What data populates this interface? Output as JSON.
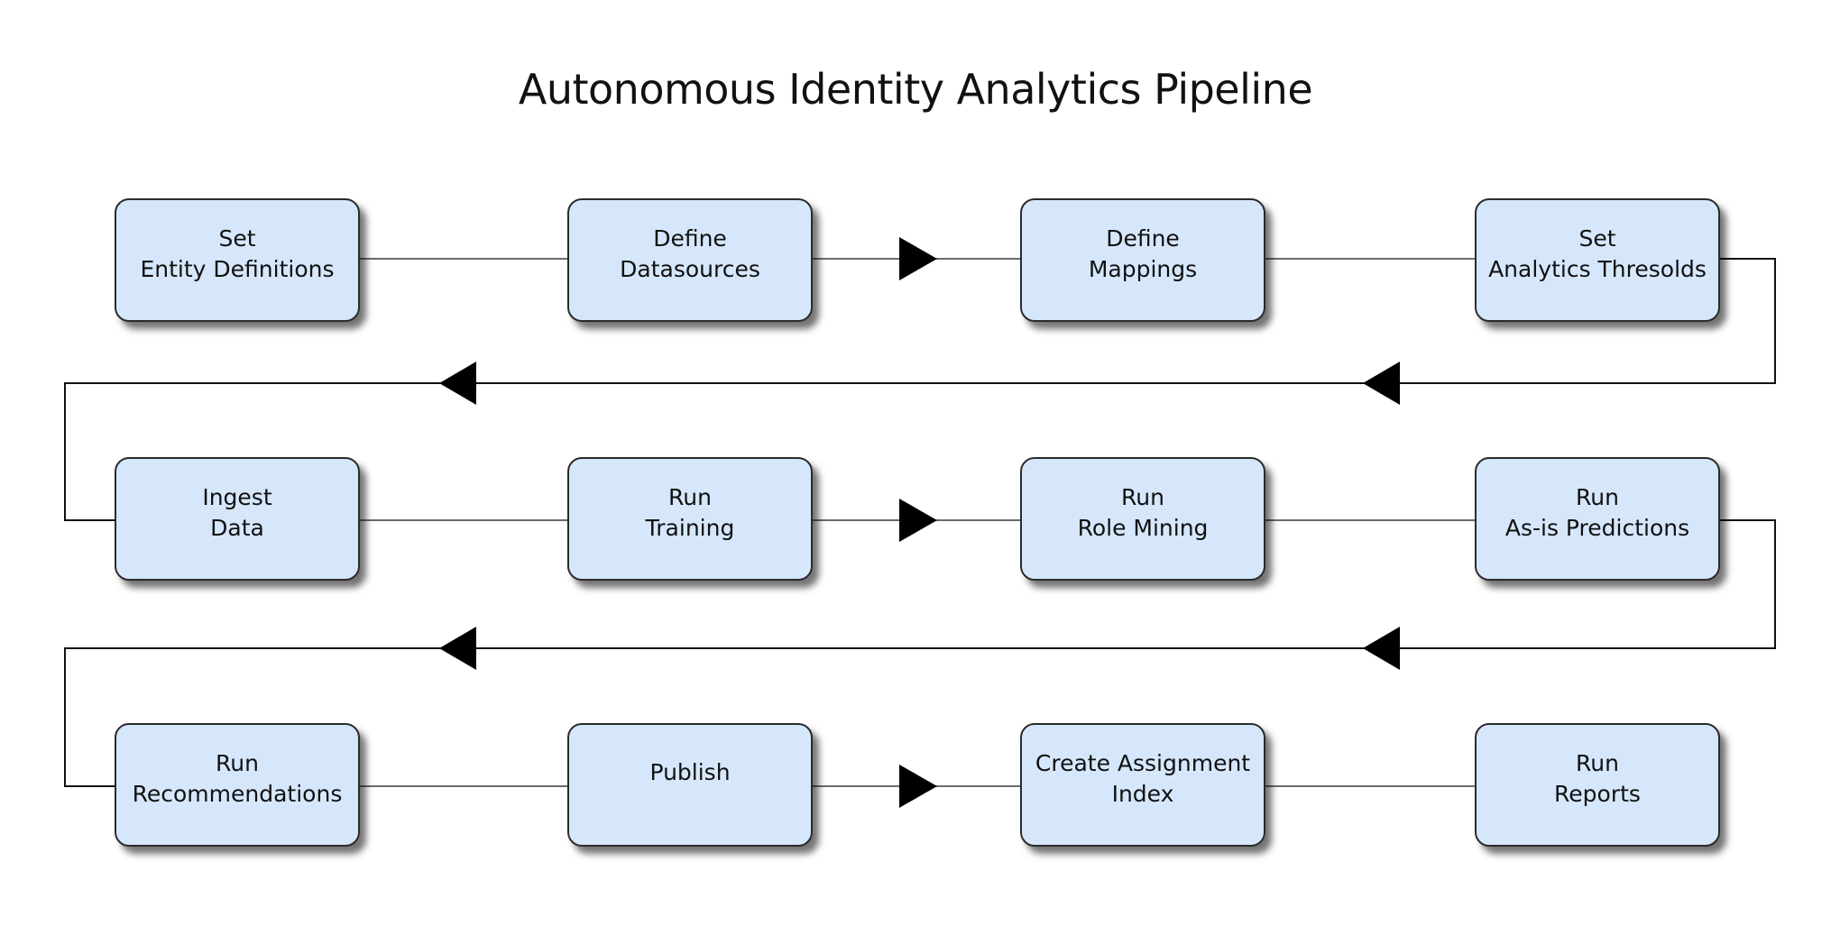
{
  "title": "Autonomous Identity Analytics Pipeline",
  "colors": {
    "node_fill": "#d6e7fb",
    "node_border": "#2b2b2b",
    "connector": "#6b6b6b",
    "return_line": "#111111",
    "arrow": "#000000"
  },
  "rows": [
    {
      "direction": "left-to-right",
      "steps": [
        {
          "lines": [
            "Set",
            "Entity Definitions"
          ]
        },
        {
          "lines": [
            "Define",
            "Datasources"
          ]
        },
        {
          "lines": [
            "Define",
            "Mappings"
          ]
        },
        {
          "lines": [
            "Set",
            "Analytics Thresolds"
          ]
        }
      ]
    },
    {
      "direction": "left-to-right",
      "steps": [
        {
          "lines": [
            "Ingest",
            "Data"
          ]
        },
        {
          "lines": [
            "Run",
            "Training"
          ]
        },
        {
          "lines": [
            "Run",
            "Role Mining"
          ]
        },
        {
          "lines": [
            "Run",
            "As-is Predictions"
          ]
        }
      ]
    },
    {
      "direction": "left-to-right",
      "steps": [
        {
          "lines": [
            "Run",
            "Recommendations"
          ]
        },
        {
          "lines": [
            "Publish"
          ]
        },
        {
          "lines": [
            "Create Assignment",
            "Index"
          ]
        },
        {
          "lines": [
            "Run",
            "Reports"
          ]
        }
      ]
    }
  ]
}
